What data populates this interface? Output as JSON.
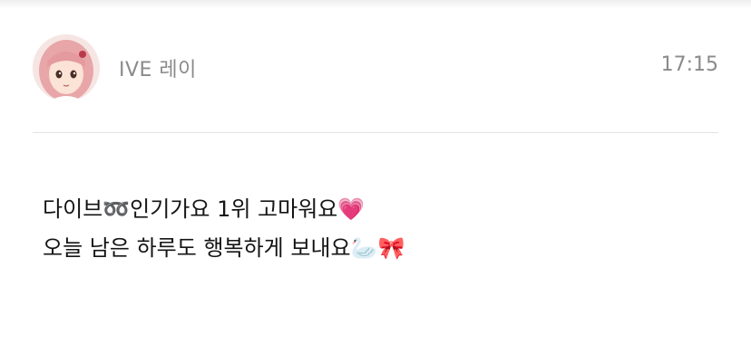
{
  "post": {
    "sender_name": "IVE 레이",
    "time": "17:15",
    "message_lines": [
      "다이브➿인기가요 1위 고마워요💗",
      "오늘 남은 하루도 행복하게 보내요🦢🎀"
    ]
  },
  "colors": {
    "meta_text": "#8a8a8a",
    "body_text": "#141414",
    "divider": "#e2e2e2"
  }
}
